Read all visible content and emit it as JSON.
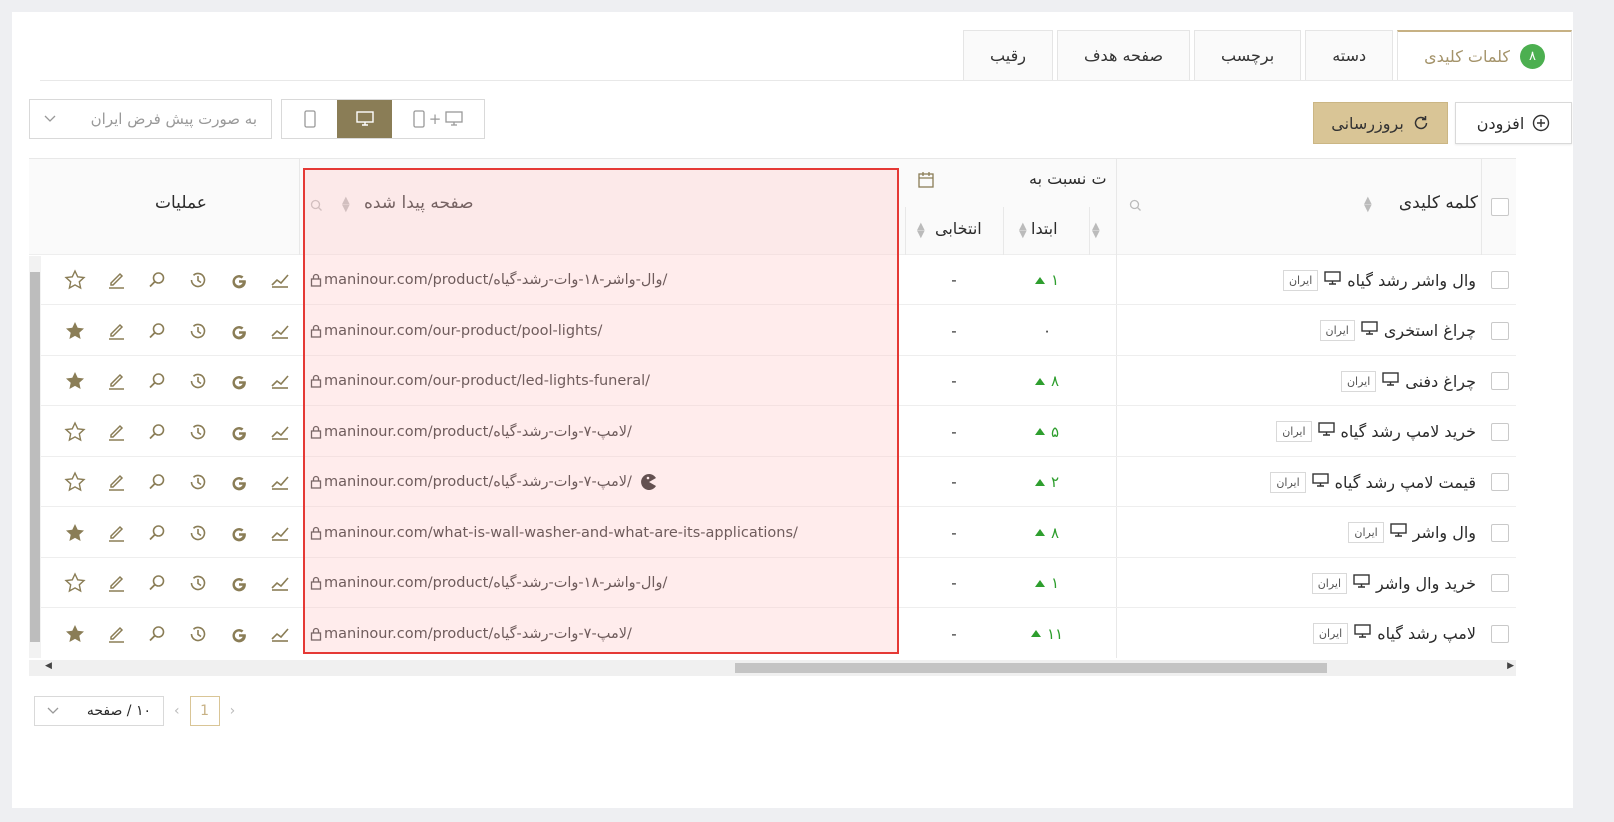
{
  "tabs": [
    {
      "label": "کلمات کلیدی",
      "badge": "۸",
      "active": true
    },
    {
      "label": "دسته"
    },
    {
      "label": "برچسب"
    },
    {
      "label": "صفحه هدف"
    },
    {
      "label": "رقیب"
    }
  ],
  "toolbar": {
    "add_label": "افزودن",
    "refresh_label": "بروزرسانی",
    "region_select": "به صورت پیش فرض ایران"
  },
  "table": {
    "col_keyword": "کلمه کلیدی",
    "col_change_group": "ت نسبت به",
    "col_start": "ابتدا",
    "col_selected": "انتخابی",
    "col_page": "صفحه پیدا شده",
    "col_ops": "عملیات",
    "rows": [
      {
        "keyword": "وال واشر رشد گیاه",
        "tag": "ایران",
        "start": "۱",
        "start_up": true,
        "selected": "-",
        "url": "maninour.com/product/وال-واشر-۱۸-وات-رشد-گیاه/",
        "starred": false
      },
      {
        "keyword": "چراغ استخری",
        "tag": "ایران",
        "start": "۰",
        "start_up": false,
        "selected": "-",
        "url": "maninour.com/our-product/pool-lights/",
        "starred": true
      },
      {
        "keyword": "چراغ دفنی",
        "tag": "ایران",
        "start": "۸",
        "start_up": true,
        "selected": "-",
        "url": "maninour.com/our-product/led-lights-funeral/",
        "starred": true
      },
      {
        "keyword": "خرید لامپ رشد گیاه",
        "tag": "ایران",
        "start": "۵",
        "start_up": true,
        "selected": "-",
        "url": "maninour.com/product/لامپ-۷-وات-رشد-گیاه/",
        "starred": false
      },
      {
        "keyword": "قیمت لامپ رشد گیاه",
        "tag": "ایران",
        "start": "۲",
        "start_up": true,
        "selected": "-",
        "url": "maninour.com/product/لامپ-۷-وات-رشد-گیاه/",
        "starred": false,
        "cannibal": true
      },
      {
        "keyword": "وال واشر",
        "tag": "ایران",
        "start": "۸",
        "start_up": true,
        "selected": "-",
        "url": "maninour.com/what-is-wall-washer-and-what-are-its-applications/",
        "starred": true
      },
      {
        "keyword": "خرید وال واشر",
        "tag": "ایران",
        "start": "۱",
        "start_up": true,
        "selected": "-",
        "url": "maninour.com/product/وال-واشر-۱۸-وات-رشد-گیاه/",
        "starred": false
      },
      {
        "keyword": "لامپ رشد گیاه",
        "tag": "ایران",
        "start": "۱۱",
        "start_up": true,
        "selected": "-",
        "url": "maninour.com/product/لامپ-۷-وات-رشد-گیاه/",
        "starred": true
      }
    ]
  },
  "pagination": {
    "page_size": "۱۰ / صفحه",
    "current": "1"
  },
  "colors": {
    "accent": "#c7b184",
    "accent_dark": "#8a7d56",
    "up": "#2e9e2e",
    "highlight": "#e53935"
  }
}
